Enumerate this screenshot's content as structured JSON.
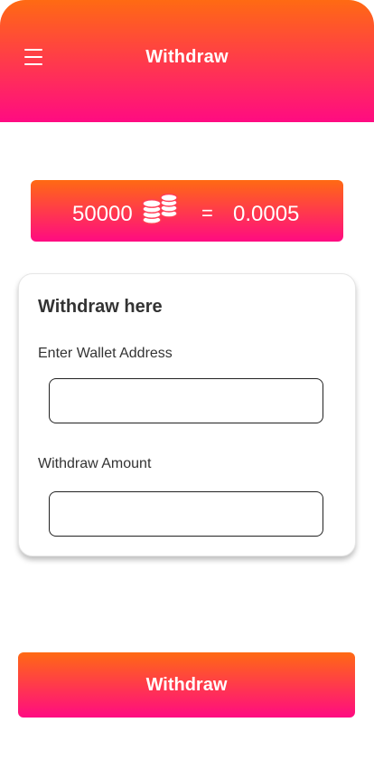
{
  "header": {
    "title": "Withdraw",
    "menu_icon": "menu-icon"
  },
  "rate": {
    "coins": "50000",
    "coins_icon": "coins-stack-icon",
    "equals": "=",
    "value": "0.0005"
  },
  "form": {
    "title": "Withdraw here",
    "wallet_label": "Enter Wallet Address",
    "wallet_value": "",
    "amount_label": "Withdraw Amount",
    "amount_value": ""
  },
  "submit": {
    "label": "Withdraw"
  },
  "colors": {
    "gradient_top": "#ff6a13",
    "gradient_bottom": "#ff0b82"
  }
}
